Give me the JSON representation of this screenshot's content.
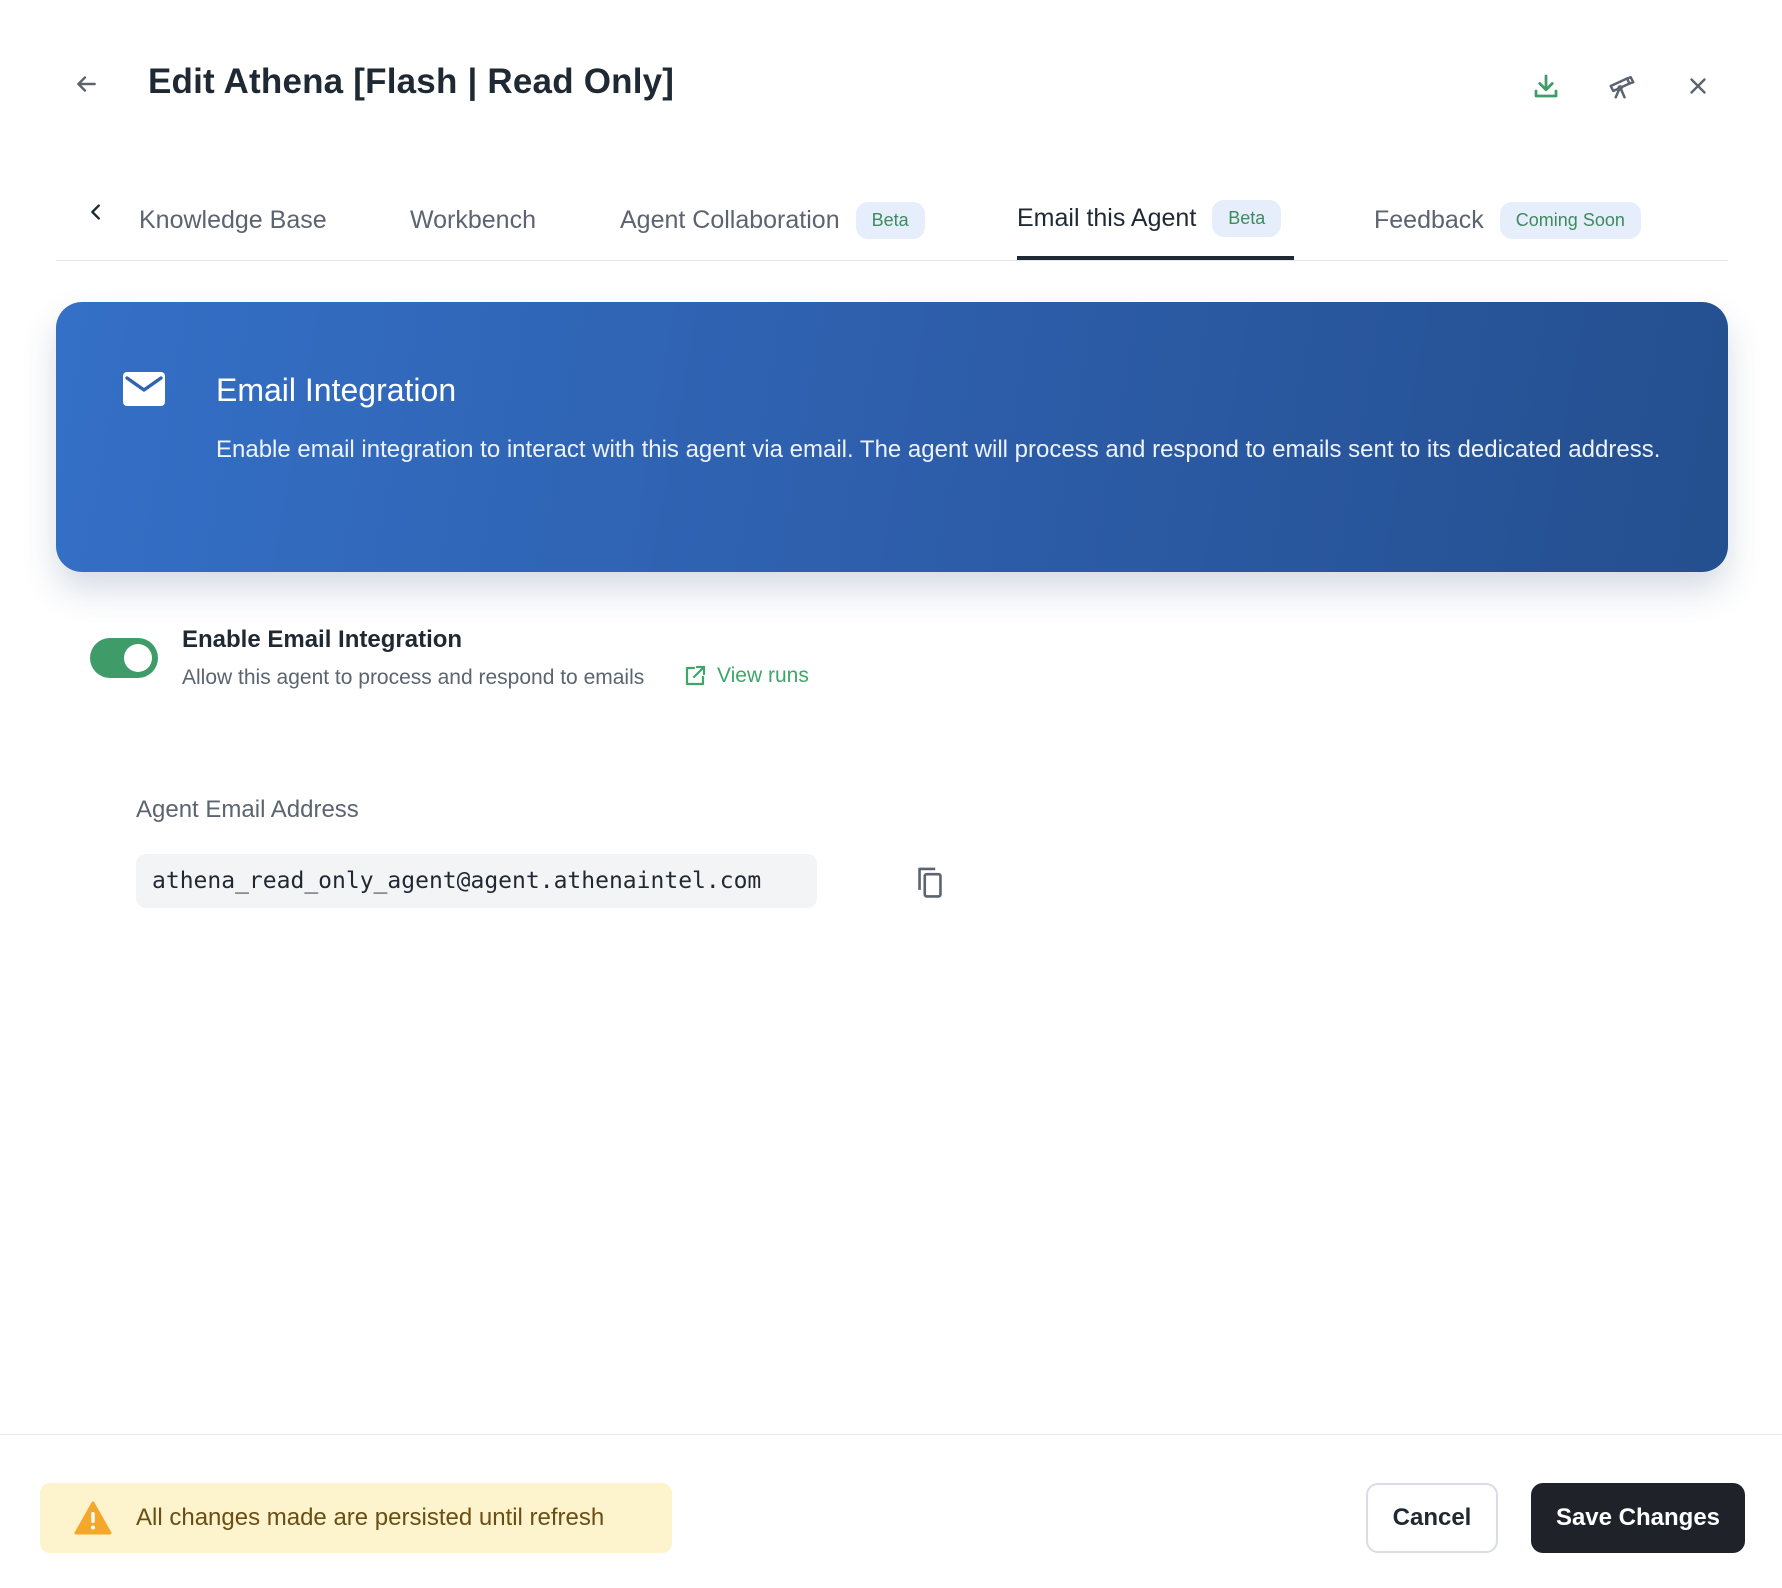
{
  "header": {
    "title": "Edit Athena [Flash | Read Only]",
    "icons": [
      "back-arrow-icon",
      "download-icon",
      "telescope-icon",
      "close-icon"
    ]
  },
  "tabs": [
    {
      "label": "Knowledge Base",
      "badge": ""
    },
    {
      "label": "Workbench",
      "badge": ""
    },
    {
      "label": "Agent Collaboration",
      "badge": "Beta"
    },
    {
      "label": "Email this Agent",
      "badge": "Beta",
      "active": true
    },
    {
      "label": "Feedback",
      "badge": "Coming Soon"
    }
  ],
  "banner": {
    "icon": "mail-icon",
    "title": "Email Integration",
    "description": "Enable email integration to interact with this agent via email. The agent will process and respond to emails sent to its dedicated address."
  },
  "integration": {
    "enabled": true,
    "label": "Enable Email Integration",
    "sublabel": "Allow this agent to process and respond to emails",
    "view_runs": "View runs"
  },
  "address": {
    "label": "Agent Email Address",
    "value": "athena_read_only_agent@agent.athenaintel.com"
  },
  "footer": {
    "notice": "All changes made are persisted until refresh",
    "cancel": "Cancel",
    "save": "Save Changes"
  },
  "colors": {
    "accent_green": "#3f9c68",
    "banner_blue": "#3470c7",
    "dark_button": "#1f2329",
    "notice_bg": "#fdf3cd"
  }
}
